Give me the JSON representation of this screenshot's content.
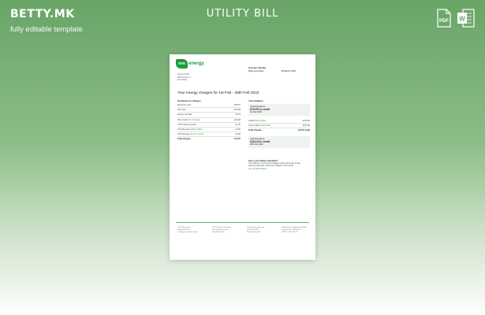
{
  "brand": {
    "name": "BETTY.MK",
    "tagline": "fully editable template"
  },
  "title": "UTILITY BILL",
  "formats": [
    {
      "icon": "pdf-file-icon",
      "label": "PDF",
      "color": "#ffffff"
    },
    {
      "icon": "word-file-icon",
      "label": "W",
      "color": "#ffffff"
    }
  ],
  "document": {
    "logo_mark": "ovo",
    "logo_word": "energy",
    "address": [
      "James Smith",
      "269 Oxford Ln",
      "Ana Street"
    ],
    "account": [
      {
        "label": "Account number",
        "value": ""
      },
      {
        "label": "Date generated",
        "value": "18 March 2022"
      }
    ],
    "charges_title": "Your energy charges for 1st Feb - 28th Feb 2022",
    "summary_title": "Summary of charges",
    "summary_rows": [
      {
        "label": "Electricity total",
        "value": "£58.97"
      },
      {
        "label": "Gas total",
        "value": "£43.60"
      },
      {
        "label": "Energy subtotal",
        "value": "£5.14"
      },
      {
        "label": "Plan credit",
        "note": "2% of energy",
        "value": "-£16.48"
      },
      {
        "label": "OVO Interest earned",
        "value": "£1.25"
      },
      {
        "label": "OVO Beyond",
        "note": "Carbon offset",
        "value": "£0.00"
      },
      {
        "label": "OVO Energy",
        "note": "cost of 1 month",
        "value": "£4.60"
      }
    ],
    "summary_total": {
      "label": "Total charges",
      "value": "£75.97"
    },
    "balance_title": "Your balance",
    "opening_panel": {
      "label": "Opening balance",
      "amount": "£179.87 in credit",
      "date": "1st Feb 2022"
    },
    "balance_rows": [
      {
        "label": "Added",
        "note": "Direct Debit",
        "value": "£100.00"
      },
      {
        "label": "Total credits",
        "note": "Direct Debit",
        "value": "£100.00"
      },
      {
        "label": "Total charges",
        "value": "£75.97 debit"
      }
    ],
    "closing_panel": {
      "label": "Closing balance",
      "amount": "£134.24 in credit",
      "date": "28th Feb 2022"
    },
    "note": {
      "heading": "How is your balance calculated?",
      "body": "Your balance is your account balance at the start of the month, plus any payments, minus your charges for the month.",
      "link": "ovo.com/help-balance"
    },
    "footer": [
      [
        "OVO Energy Ltd",
        "Registered office",
        "1 Rivergate, Temple Quay"
      ],
      [
        "OVO Energy - Energy for",
        "the way you live now",
        "Bristol BS1 6ED"
      ],
      [
        "hello@ovoenergy.com",
        "0330 303 5063",
        "Mon-Fri 8am-8pm"
      ],
      [
        "Registered in England and Wales",
        "Company No. 06890795",
        "VAT No. 100 0001 52"
      ]
    ]
  }
}
